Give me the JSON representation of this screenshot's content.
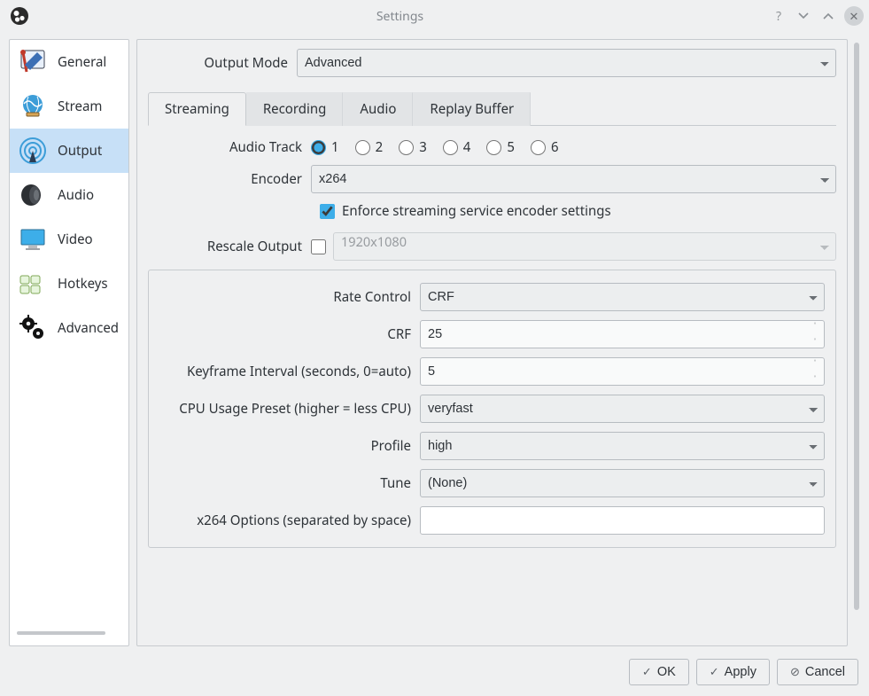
{
  "window": {
    "title": "Settings"
  },
  "sidebar": {
    "items": [
      {
        "label": "General"
      },
      {
        "label": "Stream"
      },
      {
        "label": "Output"
      },
      {
        "label": "Audio"
      },
      {
        "label": "Video"
      },
      {
        "label": "Hotkeys"
      },
      {
        "label": "Advanced"
      }
    ],
    "active_index": 2
  },
  "output_mode": {
    "label": "Output Mode",
    "value": "Advanced"
  },
  "tabs": {
    "items": [
      {
        "label": "Streaming"
      },
      {
        "label": "Recording"
      },
      {
        "label": "Audio"
      },
      {
        "label": "Replay Buffer"
      }
    ],
    "active_index": 0
  },
  "streaming": {
    "audio_track": {
      "label": "Audio Track",
      "options": [
        "1",
        "2",
        "3",
        "4",
        "5",
        "6"
      ],
      "selected": "1"
    },
    "encoder": {
      "label": "Encoder",
      "value": "x264"
    },
    "enforce": {
      "label": "Enforce streaming service encoder settings",
      "checked": true
    },
    "rescale": {
      "label": "Rescale Output",
      "checked": false,
      "value": "1920x1080"
    },
    "rate_control": {
      "label": "Rate Control",
      "value": "CRF"
    },
    "crf": {
      "label": "CRF",
      "value": "25"
    },
    "keyframe": {
      "label": "Keyframe Interval (seconds, 0=auto)",
      "value": "5"
    },
    "cpu_preset": {
      "label": "CPU Usage Preset (higher = less CPU)",
      "value": "veryfast"
    },
    "profile": {
      "label": "Profile",
      "value": "high"
    },
    "tune": {
      "label": "Tune",
      "value": "(None)"
    },
    "x264_opts": {
      "label": "x264 Options (separated by space)",
      "value": ""
    }
  },
  "footer": {
    "ok": "OK",
    "apply": "Apply",
    "cancel": "Cancel"
  }
}
